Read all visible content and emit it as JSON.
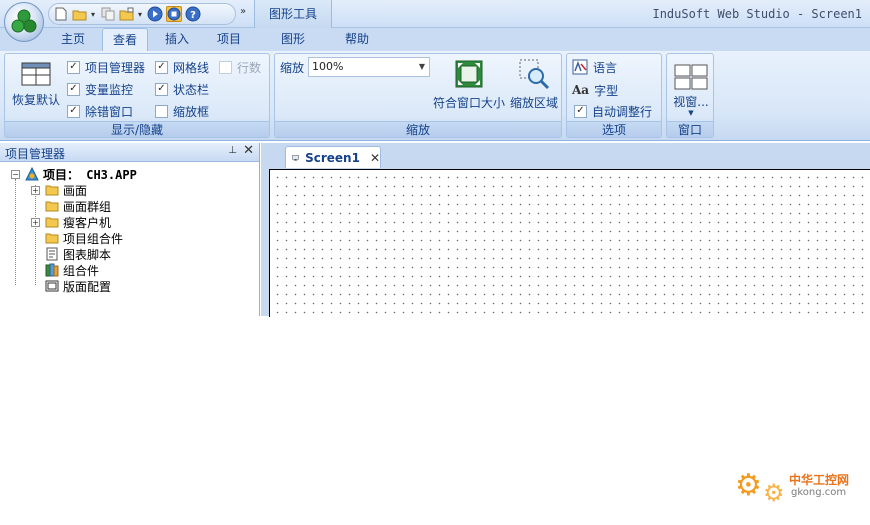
{
  "window_title": "InduSoft Web Studio - Screen1",
  "context_tab_group": "图形工具",
  "tabs": [
    {
      "label": "主页"
    },
    {
      "label": "查看"
    },
    {
      "label": "插入"
    },
    {
      "label": "项目"
    },
    {
      "label": "图形"
    },
    {
      "label": "帮助"
    }
  ],
  "active_tab": "查看",
  "ribbon": {
    "show_hide": {
      "label": "显示/隐藏",
      "restore_default": "恢复默认",
      "checks": [
        {
          "label": "项目管理器",
          "checked": true,
          "enabled": true
        },
        {
          "label": "变量监控",
          "checked": true,
          "enabled": true
        },
        {
          "label": "除错窗口",
          "checked": true,
          "enabled": true
        },
        {
          "label": "网格线",
          "checked": true,
          "enabled": true
        },
        {
          "label": "状态栏",
          "checked": true,
          "enabled": true
        },
        {
          "label": "缩放框",
          "checked": false,
          "enabled": true
        },
        {
          "label": "行数",
          "checked": false,
          "enabled": false
        }
      ]
    },
    "zoom": {
      "label": "缩放",
      "zoom_label": "缩放",
      "zoom_value": "100%",
      "fit_window": "符合窗口大小",
      "zoom_area": "缩放区域"
    },
    "options": {
      "label": "选项",
      "language": "语言",
      "font": "字型",
      "auto_wrap": "自动调整行",
      "auto_wrap_checked": true
    },
    "window": {
      "label": "窗口",
      "view_window": "视窗..."
    }
  },
  "project_manager": {
    "title": "项目管理器",
    "root": "项目： CH3.APP",
    "items": [
      {
        "label": "画面",
        "expandable": true,
        "icon": "folder-icon"
      },
      {
        "label": "画面群组",
        "expandable": false,
        "icon": "folder-icon"
      },
      {
        "label": "瘦客户机",
        "expandable": true,
        "icon": "folder-icon"
      },
      {
        "label": "项目组合件",
        "expandable": false,
        "icon": "folder-icon"
      },
      {
        "label": "图表脚本",
        "expandable": false,
        "icon": "script-icon"
      },
      {
        "label": "组合件",
        "expandable": false,
        "icon": "library-icon"
      },
      {
        "label": "版面配置",
        "expandable": false,
        "icon": "layout-icon"
      }
    ]
  },
  "document": {
    "tab_label": "Screen1"
  },
  "watermark": {
    "line1": "中华工控网",
    "line2": "gkong.com"
  },
  "colors": {
    "ribbon_text": "#15428b",
    "accent_orange": "#f39a1f"
  }
}
